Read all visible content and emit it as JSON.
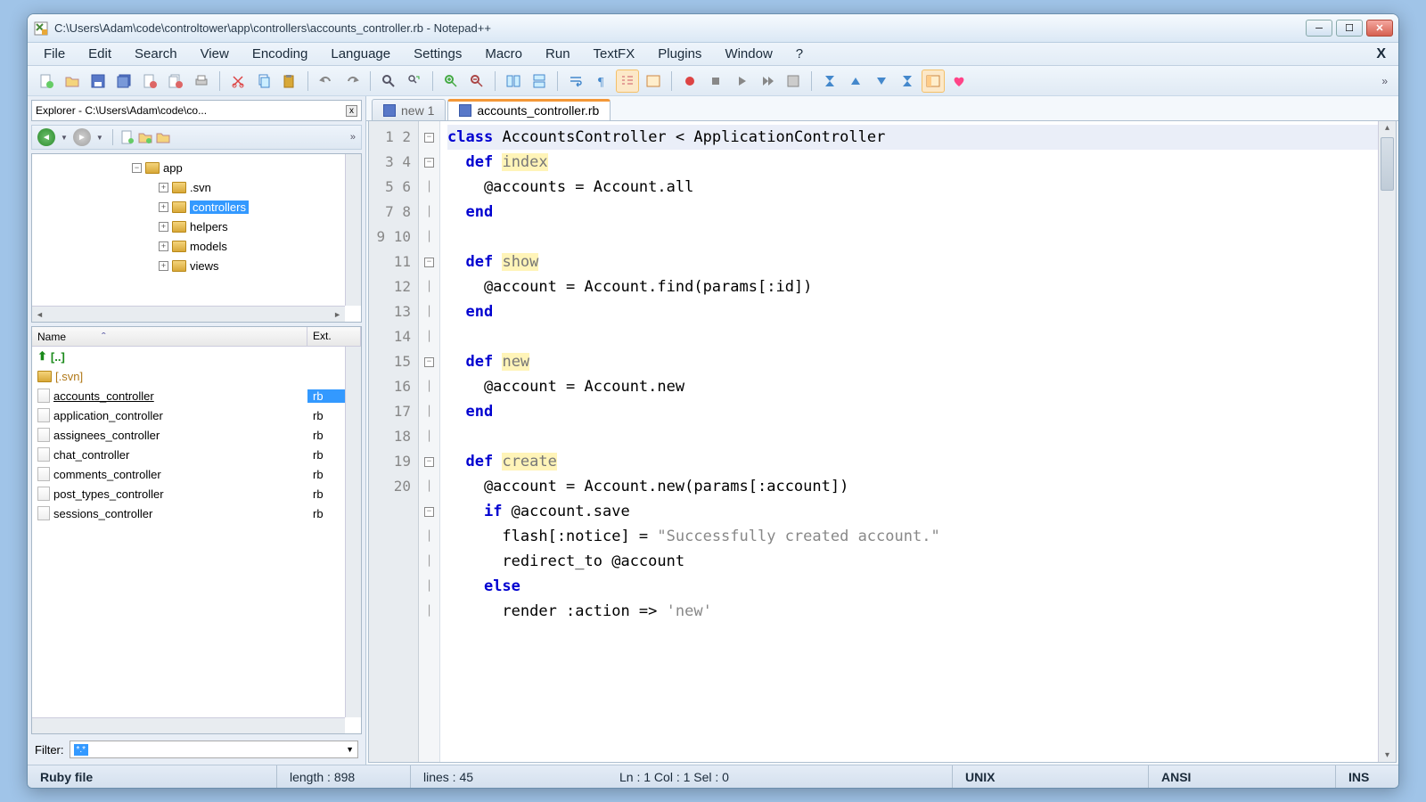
{
  "window": {
    "title": "C:\\Users\\Adam\\code\\controltower\\app\\controllers\\accounts_controller.rb - Notepad++"
  },
  "menu": {
    "items": [
      "File",
      "Edit",
      "Search",
      "View",
      "Encoding",
      "Language",
      "Settings",
      "Macro",
      "Run",
      "TextFX",
      "Plugins",
      "Window",
      "?"
    ],
    "closeDoc": "X"
  },
  "explorer": {
    "title": "Explorer - C:\\Users\\Adam\\code\\co...",
    "tree": [
      {
        "indent": 100,
        "expander": "−",
        "label": "app",
        "selected": false
      },
      {
        "indent": 130,
        "expander": "+",
        "label": ".svn",
        "selected": false
      },
      {
        "indent": 130,
        "expander": "+",
        "label": "controllers",
        "selected": true
      },
      {
        "indent": 130,
        "expander": "+",
        "label": "helpers",
        "selected": false
      },
      {
        "indent": 130,
        "expander": "+",
        "label": "models",
        "selected": false
      },
      {
        "indent": 130,
        "expander": "+",
        "label": "views",
        "selected": false
      }
    ],
    "header": {
      "name": "Name",
      "ext": "Ext."
    },
    "files": [
      {
        "name": "[..]",
        "ext": "",
        "type": "up"
      },
      {
        "name": "[.svn]",
        "ext": "",
        "type": "folder"
      },
      {
        "name": "accounts_controller",
        "ext": "rb",
        "type": "file",
        "selected": true,
        "underline": true
      },
      {
        "name": "application_controller",
        "ext": "rb",
        "type": "file"
      },
      {
        "name": "assignees_controller",
        "ext": "rb",
        "type": "file"
      },
      {
        "name": "chat_controller",
        "ext": "rb",
        "type": "file"
      },
      {
        "name": "comments_controller",
        "ext": "rb",
        "type": "file"
      },
      {
        "name": "post_types_controller",
        "ext": "rb",
        "type": "file"
      },
      {
        "name": "sessions_controller",
        "ext": "rb",
        "type": "file"
      }
    ],
    "filterLabel": "Filter:",
    "filterChip": "*.*"
  },
  "tabs": [
    {
      "label": "new  1",
      "active": false
    },
    {
      "label": "accounts_controller.rb",
      "active": true
    }
  ],
  "code": {
    "lines": 20
  },
  "status": {
    "filetype": "Ruby file",
    "length": "length : 898",
    "lines": "lines : 45",
    "pos": "Ln : 1   Col : 1   Sel : 0",
    "eol": "UNIX",
    "enc": "ANSI",
    "mode": "INS"
  }
}
